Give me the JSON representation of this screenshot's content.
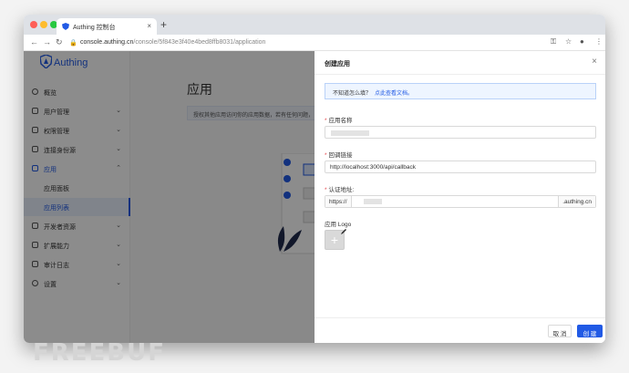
{
  "browser": {
    "tab_title": "Authing 控制台",
    "tab_close": "×",
    "new_tab": "+",
    "url_host": "console.authing.cn",
    "url_path": "/console/5f843e3f40e4bed8ffb8031/application"
  },
  "sidebar": {
    "logo_text": "Authing",
    "items": [
      {
        "label": "概览"
      },
      {
        "label": "用户管理"
      },
      {
        "label": "权限管理"
      },
      {
        "label": "连接身份源"
      },
      {
        "label": "应用"
      },
      {
        "label": "应用面板"
      },
      {
        "label": "应用列表"
      },
      {
        "label": "开发者资源"
      },
      {
        "label": "扩展能力"
      },
      {
        "label": "审计日志"
      },
      {
        "label": "设置"
      }
    ]
  },
  "main": {
    "title": "应用",
    "description": "授权其他应用访问你的应用数据，若有任何问题，"
  },
  "drawer": {
    "title": "创建应用",
    "info_text": "不知道怎么填？",
    "info_link": "点此查看文档。",
    "app_name_label": "应用名称",
    "callback_label": "回调链接",
    "callback_value": "http://localhost:3000/api/callback",
    "auth_address_label": "认证地址:",
    "auth_prefix": "https://",
    "auth_suffix": ".authing.cn",
    "logo_label": "应用 Logo",
    "upload_plus": "+",
    "cancel_label": "取 消",
    "create_label": "创 建"
  },
  "watermark": "FREEBUF",
  "colors": {
    "accent": "#215ae5",
    "required": "#e5484d"
  }
}
